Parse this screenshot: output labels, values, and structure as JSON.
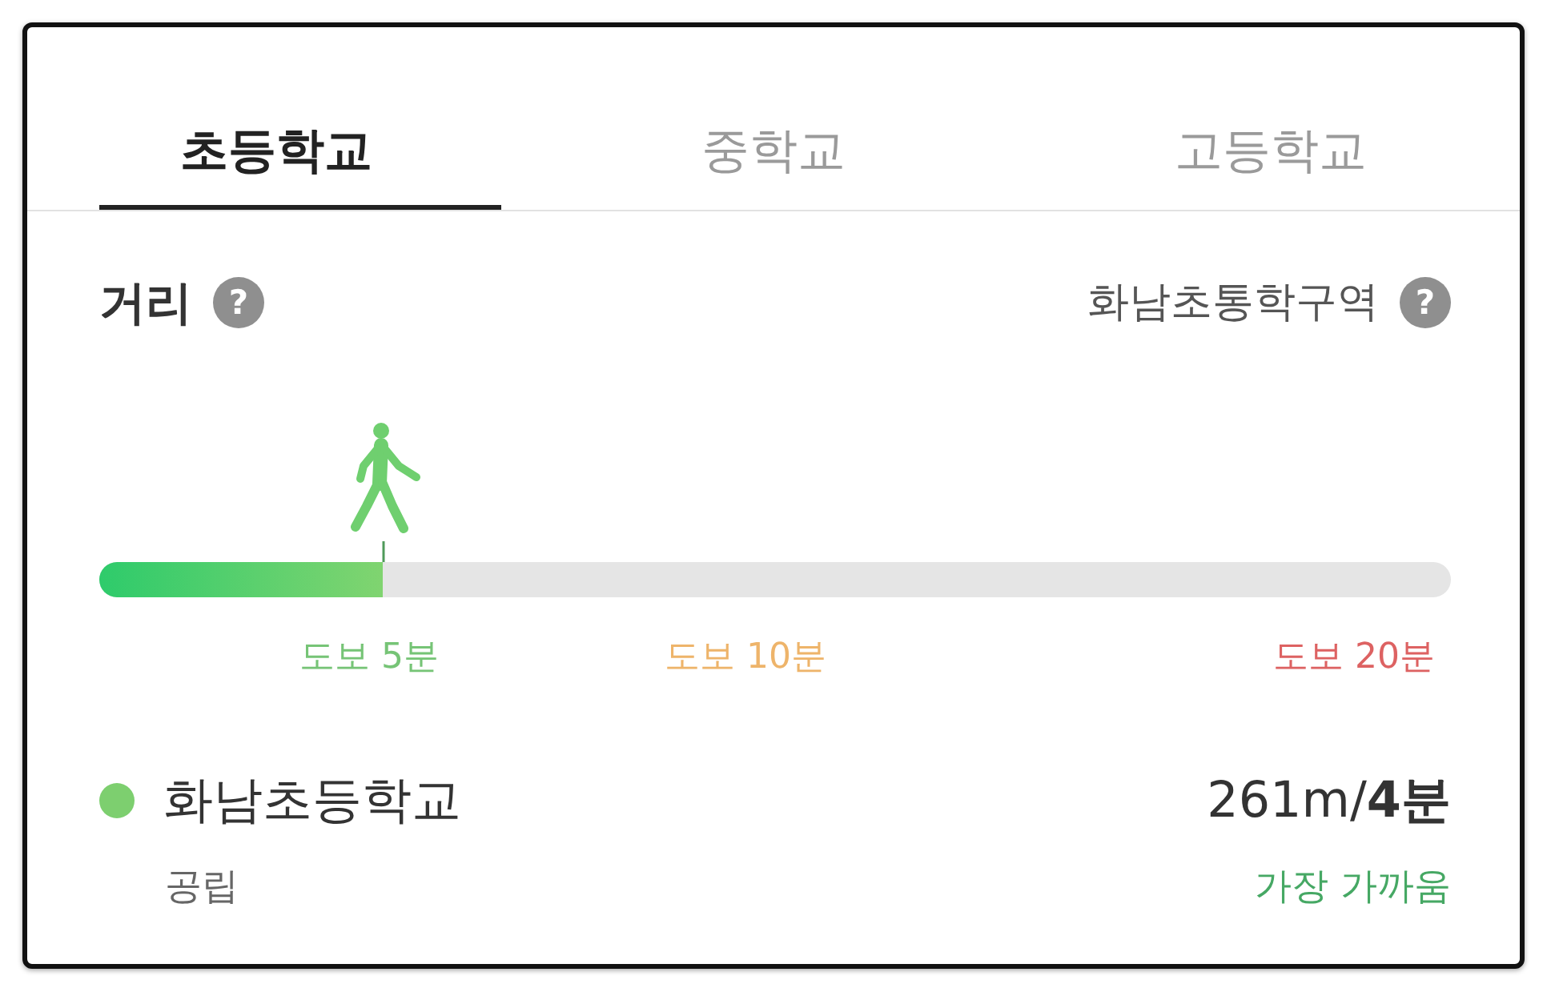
{
  "tabs": [
    {
      "label": "초등학교",
      "selected": true
    },
    {
      "label": "중학교",
      "selected": false
    },
    {
      "label": "고등학교",
      "selected": false
    }
  ],
  "distance": {
    "title": "거리",
    "title_help": "?",
    "zone": "화남초통학구역",
    "zone_help": "?",
    "level": 0.21,
    "marks": [
      {
        "label": "도보 5분",
        "color": "#76c476"
      },
      {
        "label": "도보 10분",
        "color": "#eeb46a"
      },
      {
        "label": "도보 20분",
        "color": "#dd6262"
      }
    ]
  },
  "school": {
    "color": "#7dcf6f",
    "name": "화남초등학교",
    "distance": "261m/**4분**",
    "type": "공립",
    "note": "가장 가까움"
  }
}
